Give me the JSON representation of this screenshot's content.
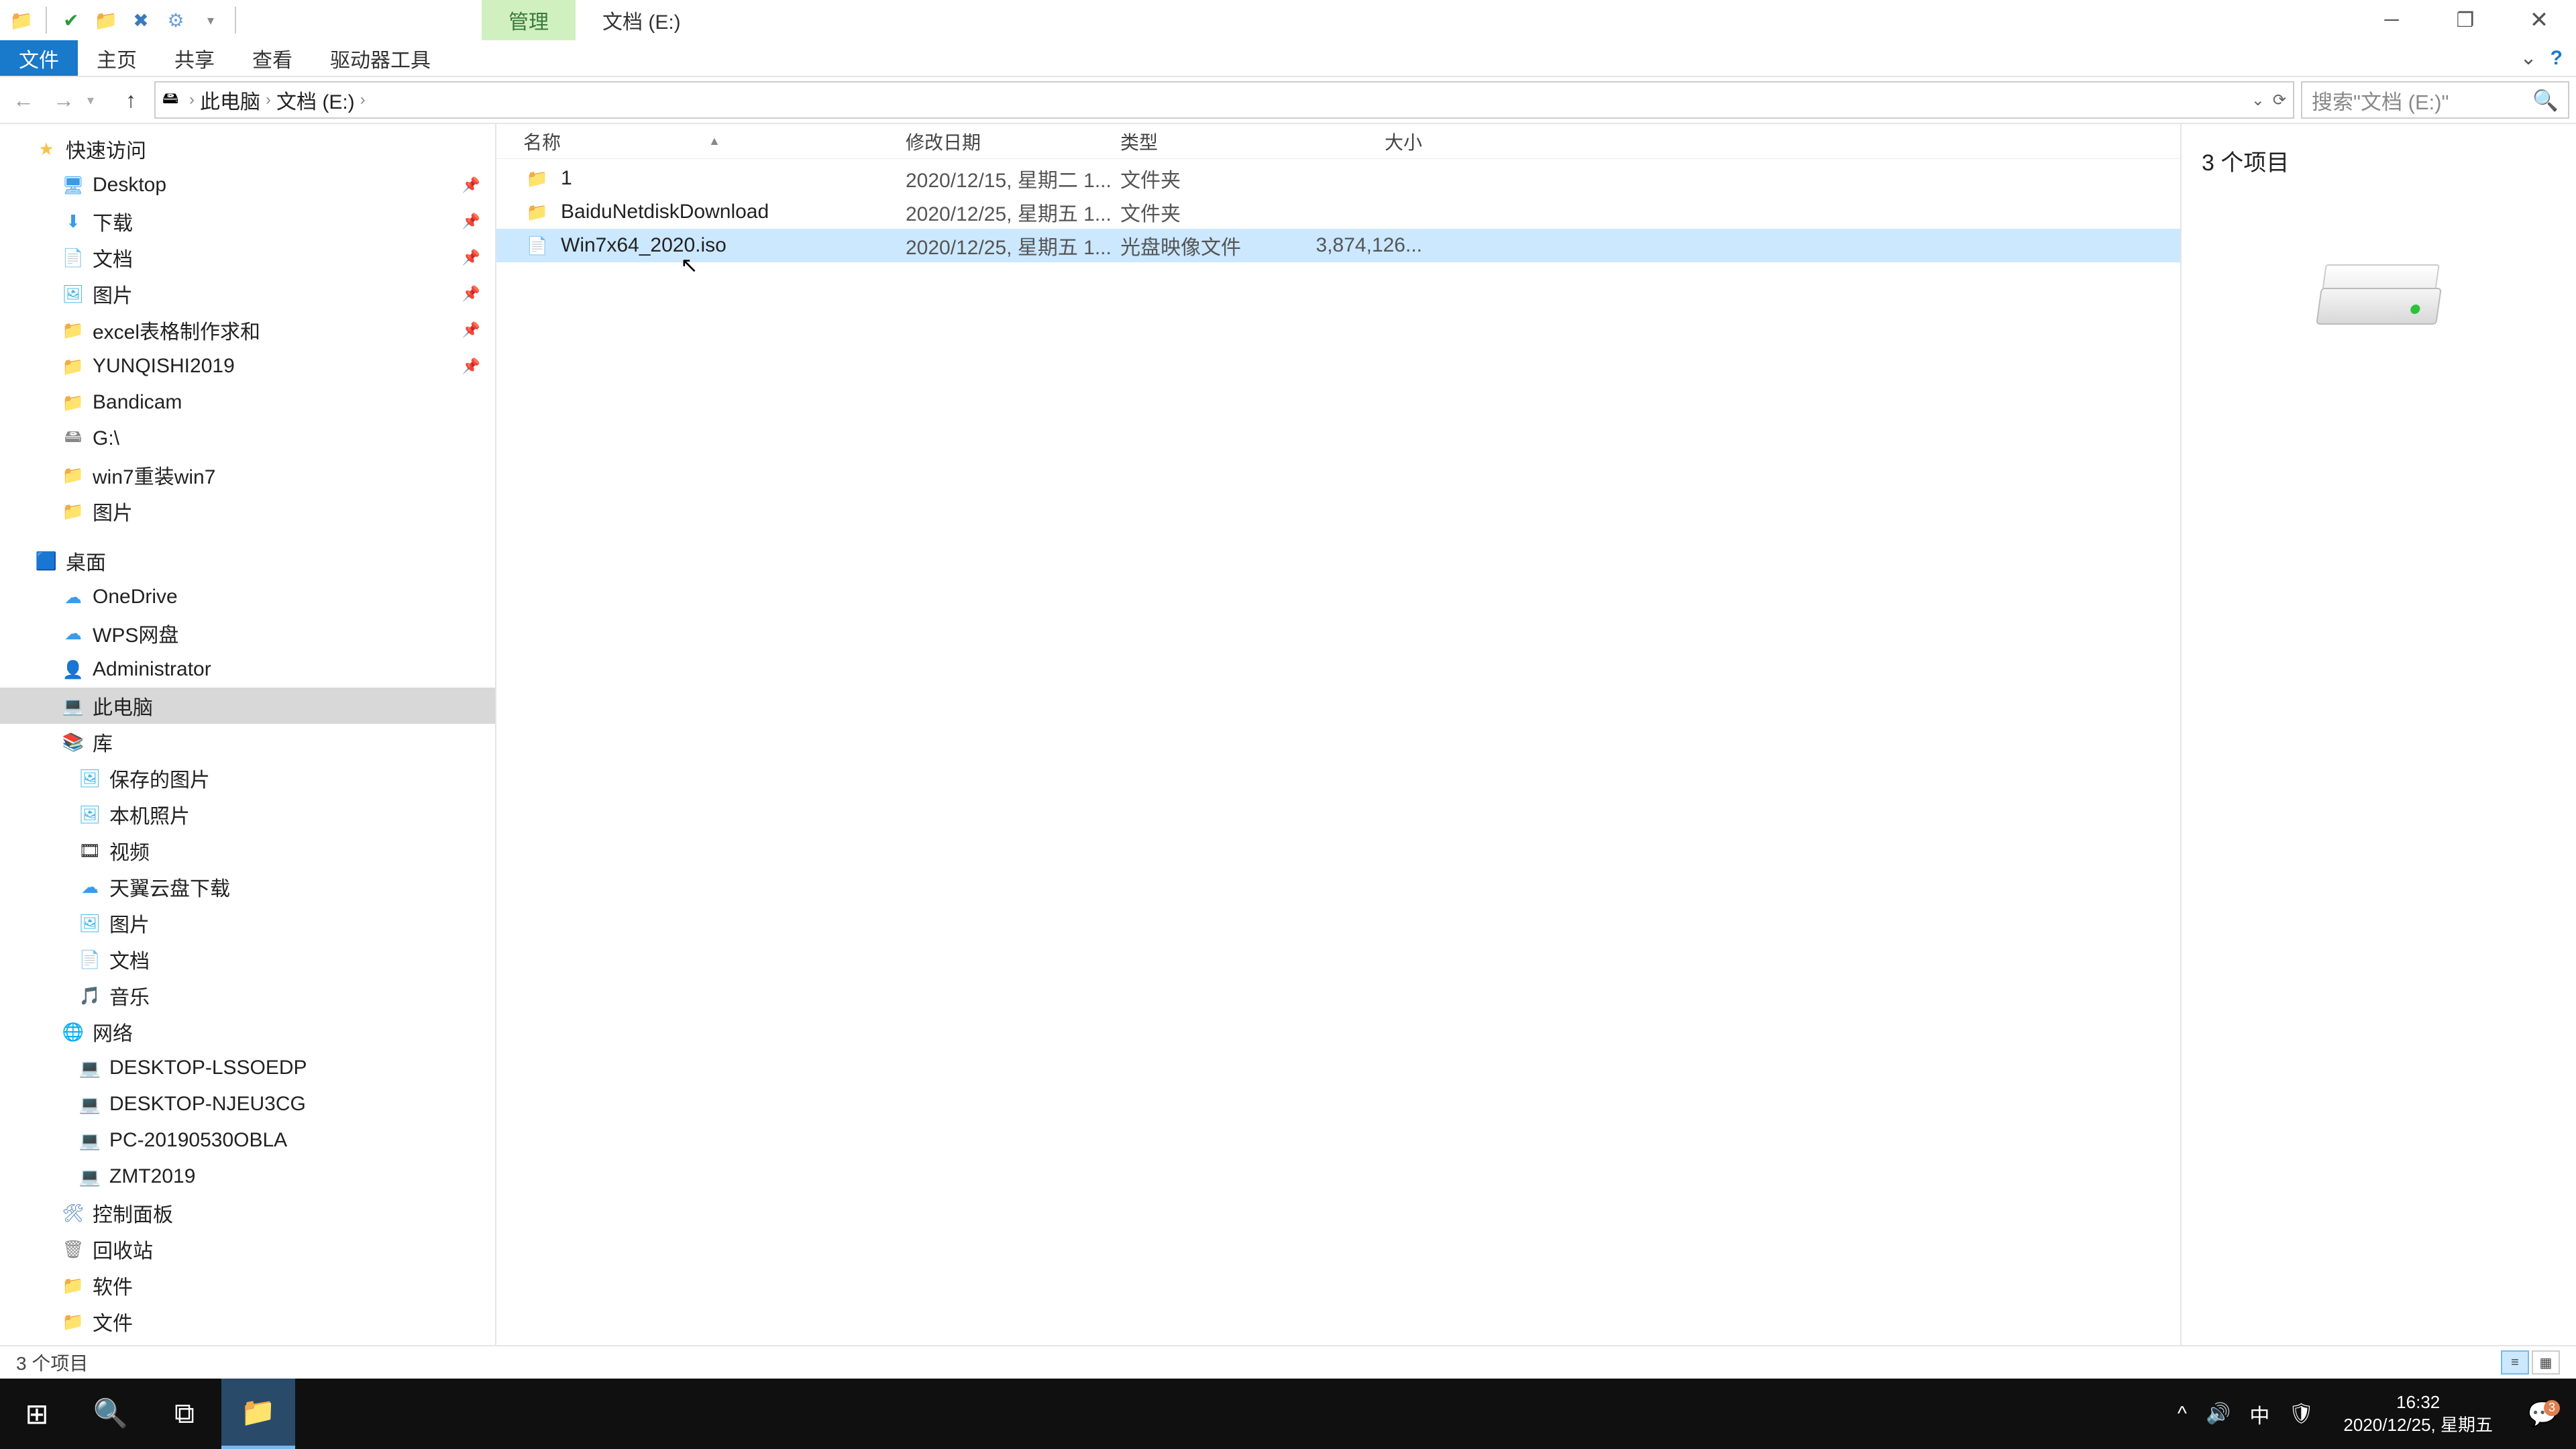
{
  "titlebar": {
    "contextual_manage": "管理",
    "location": "文档 (E:)"
  },
  "ribbon": {
    "file": "文件",
    "home": "主页",
    "share": "共享",
    "view": "查看",
    "drivetools": "驱动器工具"
  },
  "breadcrumb": {
    "this_pc": "此电脑",
    "drive": "文档 (E:)"
  },
  "search": {
    "placeholder": "搜索\"文档 (E:)\""
  },
  "tree": {
    "quick_access": "快速访问",
    "desktop": "Desktop",
    "downloads": "下载",
    "documents": "文档",
    "pictures": "图片",
    "excel": "excel表格制作求和",
    "yunqishi": "YUNQISHI2019",
    "bandicam": "Bandicam",
    "gdrive": "G:\\",
    "win7reinstall": "win7重装win7",
    "pictures2": "图片",
    "desktop2": "桌面",
    "onedrive": "OneDrive",
    "wps": "WPS网盘",
    "admin": "Administrator",
    "this_pc": "此电脑",
    "libraries": "库",
    "saved_pics": "保存的图片",
    "local_photos": "本机照片",
    "videos": "视频",
    "tianyi": "天翼云盘下载",
    "pics3": "图片",
    "docs2": "文档",
    "music": "音乐",
    "network": "网络",
    "pc1": "DESKTOP-LSSOEDP",
    "pc2": "DESKTOP-NJEU3CG",
    "pc3": "PC-20190530OBLA",
    "pc4": "ZMT2019",
    "control_panel": "控制面板",
    "recycle": "回收站",
    "software": "软件",
    "file_folder": "文件"
  },
  "columns": {
    "name": "名称",
    "date": "修改日期",
    "type": "类型",
    "size": "大小"
  },
  "files": [
    {
      "name": "1",
      "date": "2020/12/15, 星期二 1...",
      "type": "文件夹",
      "size": "",
      "icon": "folder"
    },
    {
      "name": "BaiduNetdiskDownload",
      "date": "2020/12/25, 星期五 1...",
      "type": "文件夹",
      "size": "",
      "icon": "folder"
    },
    {
      "name": "Win7x64_2020.iso",
      "date": "2020/12/25, 星期五 1...",
      "type": "光盘映像文件",
      "size": "3,874,126...",
      "icon": "file",
      "selected": true
    }
  ],
  "preview": {
    "title": "3 个项目"
  },
  "statusbar": {
    "text": "3 个项目"
  },
  "taskbar": {
    "time": "16:32",
    "date": "2020/12/25, 星期五",
    "ime": "中",
    "notif_count": "3"
  }
}
